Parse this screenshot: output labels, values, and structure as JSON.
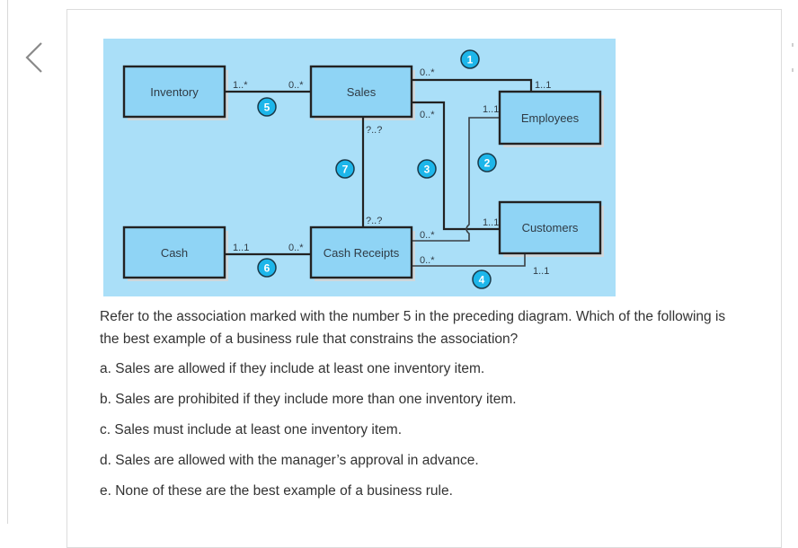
{
  "navigation": {
    "prev_icon": "chevron-left-icon",
    "next_icon": "chevron-right-icon"
  },
  "diagram": {
    "background_color": "#aadff8",
    "box_fill": "#8fd4f5",
    "badge_color": "#1db6ea",
    "classes": {
      "inventory": "Inventory",
      "sales": "Sales",
      "employees": "Employees",
      "cash": "Cash",
      "cash_receipts": "Cash Receipts",
      "customers": "Customers"
    },
    "associations": [
      {
        "number": "1",
        "from": "Sales",
        "to": "Employees",
        "from_mult": "0..*",
        "to_mult": "1..1"
      },
      {
        "number": "2",
        "from": "Cash Receipts",
        "to": "Employees",
        "from_mult": "0..*",
        "to_mult": "1..1"
      },
      {
        "number": "3",
        "from": "Sales",
        "to": "Customers",
        "from_mult": "0..*",
        "to_mult": "1..1"
      },
      {
        "number": "4",
        "from": "Cash Receipts",
        "to": "Customers",
        "from_mult": "0..*",
        "to_mult": "1..1"
      },
      {
        "number": "5",
        "from": "Inventory",
        "to": "Sales",
        "from_mult": "1..*",
        "to_mult": "0..*"
      },
      {
        "number": "6",
        "from": "Cash",
        "to": "Cash Receipts",
        "from_mult": "1..1",
        "to_mult": "0..*"
      },
      {
        "number": "7",
        "from": "Sales",
        "to": "Cash Receipts",
        "from_mult": "?..?",
        "to_mult": "?..?"
      }
    ]
  },
  "question": {
    "text": "Refer to the association marked with the number 5 in the preceding diagram. Which of the following is the best example of a business rule that constrains the association?",
    "options": [
      "a. Sales are allowed if they include at least one inventory item.",
      "b. Sales are prohibited if they include more than one inventory item.",
      "c. Sales must include at least one inventory item.",
      "d. Sales are allowed with the manager’s approval in advance.",
      "e. None of these are the best example of a business rule."
    ]
  }
}
